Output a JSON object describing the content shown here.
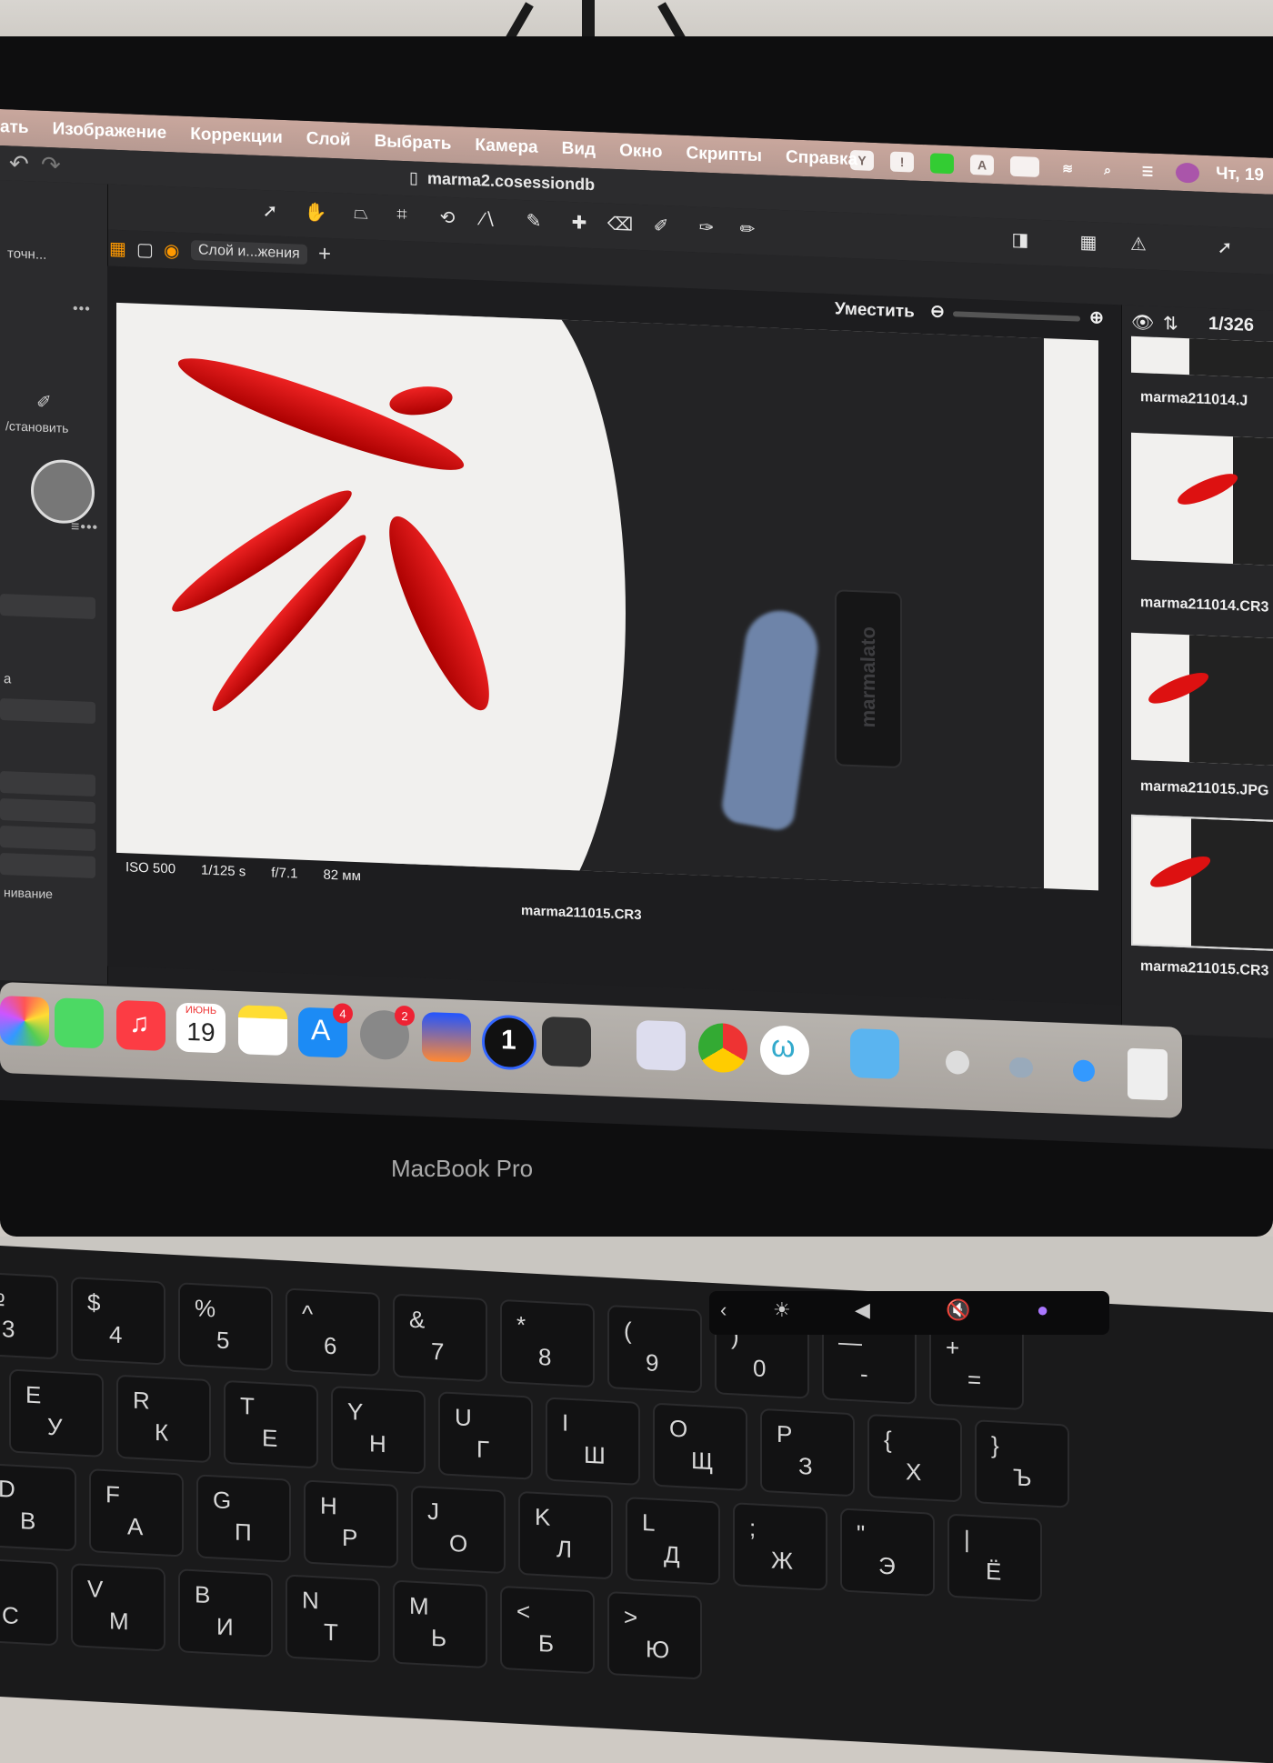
{
  "menubar": {
    "items": [
      "ать",
      "Изображение",
      "Коррекции",
      "Слой",
      "Выбрать",
      "Камера",
      "Вид",
      "Окно",
      "Скрипты",
      "Справка"
    ],
    "status_clock": "Чт, 19"
  },
  "window": {
    "title": "marma2.cosessiondb"
  },
  "toolbar": {
    "layer_selector": "Слой и...жения",
    "add_symbol": "+"
  },
  "left_panel": {
    "label_tochn": "точн...",
    "label_ustanovit": "/становить",
    "label_vyravnivanie": "нивание",
    "label_a": "a"
  },
  "viewer": {
    "fit_label": "Уместить",
    "exif": {
      "iso": "ISO 500",
      "shutter": "1/125 s",
      "aperture": "f/7.1",
      "focal": "82 мм"
    },
    "filename": "marma211015.CR3",
    "tag_text": "marmalato"
  },
  "browser": {
    "counter": "1/326",
    "thumbnails": [
      {
        "caption": "marma211014.J"
      },
      {
        "caption": "marma211014.CR3"
      },
      {
        "caption": "marma211015.JPG"
      },
      {
        "caption": "marma211015.CR3"
      }
    ]
  },
  "dock": {
    "calendar_month": "ИЮНЬ",
    "calendar_day": "19",
    "appstore_badge": "4",
    "settings_badge": "2",
    "app_w": "ω",
    "app_one": "1"
  },
  "hardware": {
    "brand": "MacBook Pro"
  },
  "keyboard": {
    "row1": [
      [
        "№",
        "3"
      ],
      [
        "$",
        "4"
      ],
      [
        "%",
        "5"
      ],
      [
        "^",
        "6"
      ],
      [
        "&",
        "7"
      ],
      [
        "*",
        "8"
      ],
      [
        "(",
        "9"
      ],
      [
        ")",
        "0"
      ],
      [
        "—",
        "-"
      ],
      [
        "+",
        "="
      ]
    ],
    "row2": [
      [
        "E",
        "У"
      ],
      [
        "R",
        "К"
      ],
      [
        "T",
        "Е"
      ],
      [
        "Y",
        "Н"
      ],
      [
        "U",
        "Г"
      ],
      [
        "I",
        "Ш"
      ],
      [
        "O",
        "Щ"
      ],
      [
        "P",
        "З"
      ],
      [
        "{",
        "Х"
      ],
      [
        "}",
        "Ъ"
      ]
    ],
    "row3": [
      [
        "D",
        "В"
      ],
      [
        "F",
        "А"
      ],
      [
        "G",
        "П"
      ],
      [
        "H",
        "Р"
      ],
      [
        "J",
        "О"
      ],
      [
        "K",
        "Л"
      ],
      [
        "L",
        "Д"
      ],
      [
        ";",
        "Ж"
      ],
      [
        "\"",
        "Э"
      ],
      [
        "|",
        "Ё"
      ]
    ],
    "row4": [
      [
        "C",
        "С"
      ],
      [
        "V",
        "М"
      ],
      [
        "B",
        "И"
      ],
      [
        "N",
        "Т"
      ],
      [
        "M",
        "Ь"
      ],
      [
        "<",
        "Б"
      ],
      [
        ">",
        "Ю"
      ]
    ]
  }
}
